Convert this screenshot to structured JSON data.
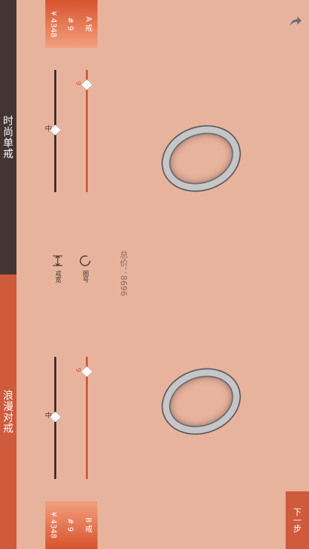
{
  "tabs": [
    {
      "label": "时尚单戒",
      "active": true
    },
    {
      "label": "浪漫对戒",
      "active": false
    }
  ],
  "rings": {
    "a": {
      "name": "A 戒",
      "size": "# 9",
      "price": "¥ 4348"
    },
    "b": {
      "name": "B 戒",
      "size": "# 9",
      "price": "¥ 4348"
    }
  },
  "sliders": {
    "a_size_value": "9",
    "a_width_value": "中",
    "b_size_value": "9",
    "b_width_value": "中"
  },
  "total": {
    "text": "总价：8696"
  },
  "controls": {
    "ring_size_label": "圈号",
    "ring_width_label": "戒宽"
  },
  "next_button": {
    "label": "下一步"
  },
  "icons": {
    "share": "share-arrow-icon",
    "circle": "ring-size-icon",
    "width": "ring-width-icon"
  },
  "colors": {
    "accent": "#cf5a3c",
    "dark": "#443532",
    "background": "#e8b39c"
  }
}
